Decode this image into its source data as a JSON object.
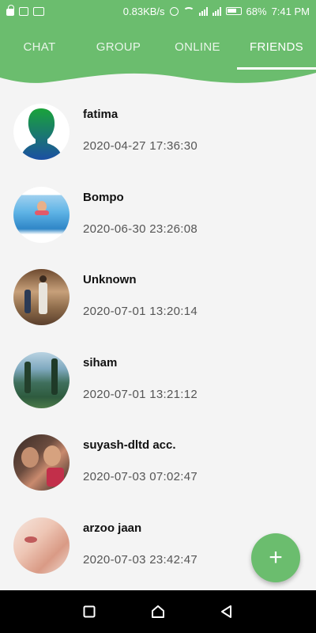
{
  "status_bar": {
    "speed": "0.83KB/s",
    "battery": "68%",
    "time": "7:41 PM"
  },
  "tabs": [
    {
      "label": "CHAT"
    },
    {
      "label": "GROUP"
    },
    {
      "label": "ONLINE"
    },
    {
      "label": "FRIENDS"
    }
  ],
  "active_tab": "FRIENDS",
  "friends": [
    {
      "name": "fatima",
      "time": "2020-04-27 17:36:30"
    },
    {
      "name": "Bompo",
      "time": "2020-06-30 23:26:08"
    },
    {
      "name": "Unknown",
      "time": "2020-07-01 13:20:14"
    },
    {
      "name": "siham",
      "time": "2020-07-01 13:21:12"
    },
    {
      "name": "suyash-dltd acc.",
      "time": "2020-07-03 07:02:47"
    },
    {
      "name": "arzoo jaan",
      "time": "2020-07-03 23:42:47"
    }
  ],
  "fab": {
    "label": "+"
  },
  "colors": {
    "accent": "#6bbd6e",
    "background": "#f4f4f4",
    "nav_bar": "#000000"
  }
}
